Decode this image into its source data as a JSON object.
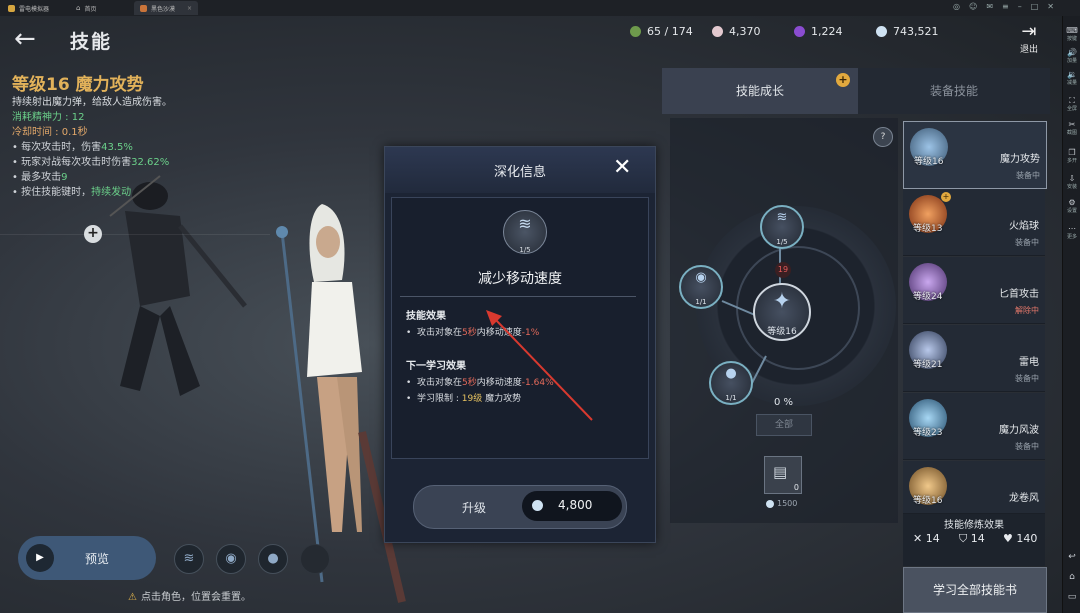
{
  "emulator": {
    "tabs": [
      {
        "label": "雷电模拟器"
      },
      {
        "label": "首页"
      },
      {
        "label": "黑色沙漠"
      }
    ],
    "sidebar": [
      {
        "icon": "keyboard-icon",
        "glyph": "⌨",
        "label": "按键"
      },
      {
        "icon": "volume-up-icon",
        "glyph": "🔊",
        "label": "加量"
      },
      {
        "icon": "volume-down-icon",
        "glyph": "🔉",
        "label": "减量"
      },
      {
        "icon": "fullscreen-icon",
        "glyph": "⛶",
        "label": "全屏"
      },
      {
        "icon": "scissors-icon",
        "glyph": "✂",
        "label": "截图"
      },
      {
        "icon": "multi-open-icon",
        "glyph": "❐",
        "label": "多开"
      },
      {
        "icon": "install-icon",
        "glyph": "⇩",
        "label": "安装"
      },
      {
        "icon": "settings-icon",
        "glyph": "⚙",
        "label": "设置"
      },
      {
        "icon": "more-icon",
        "glyph": "⋯",
        "label": "更多"
      }
    ],
    "nav": [
      {
        "icon": "back-icon",
        "glyph": "↩"
      },
      {
        "icon": "home-icon",
        "glyph": "⌂"
      },
      {
        "icon": "recent-icon",
        "glyph": "▭"
      }
    ]
  },
  "header": {
    "back_glyph": "←",
    "title": "技能",
    "resources": [
      {
        "icon": "energy-icon",
        "value": "65 / 174",
        "color": "#6e9a4c"
      },
      {
        "icon": "pearl-icon",
        "value": "4,370",
        "color": "#e3c9cf"
      },
      {
        "icon": "gem-icon",
        "value": "1,224",
        "color": "#8a4cd0"
      },
      {
        "icon": "silver-icon",
        "value": "743,521",
        "color": "#cfe2f2"
      }
    ],
    "exit_label": "退出"
  },
  "skill_info": {
    "level_name": "等级16 魔力攻势",
    "description": "持续射出魔力弹，给敌人造成伤害。",
    "cost": "消耗精神力 : 12",
    "cooldown": "冷却时间 : 0.1秒",
    "bullets": [
      {
        "text": "每次攻击时，伤害",
        "highlight": "43.5%"
      },
      {
        "text": "玩家对战每次攻击时伤害",
        "highlight": "32.62%"
      },
      {
        "text": "最多攻击",
        "highlight": "9"
      },
      {
        "text": "按住技能键时，",
        "highlight": "持续发动"
      }
    ]
  },
  "bottom_left": {
    "preview_label": "预览",
    "notice": "点击角色，位置会重置。"
  },
  "modal": {
    "title": "深化信息",
    "close": "✕",
    "skill_count": "1/5",
    "skill_name": "减少移动速度",
    "effect_title": "技能效果",
    "effect_line": {
      "pre": "攻击对象在",
      "time": "5秒",
      "mid": "内移动速度",
      "val": "-1%"
    },
    "next_title": "下一学习效果",
    "next_line": {
      "pre": "攻击对象在",
      "time": "5秒",
      "mid": "内移动速度",
      "val": "-1.64%"
    },
    "limit_line": {
      "pre": "学习限制 : ",
      "lv": "19级",
      "post": " 魔力攻势"
    },
    "upgrade_label": "升级",
    "upgrade_cost": "4,800"
  },
  "right_panel": {
    "tab_growth": "技能成长",
    "tab_equip": "装备技能",
    "tree": {
      "top_node": "1/5",
      "left_node": "1/1",
      "bottom_node": "1/1",
      "main_level": "等级16",
      "red_badge": "19",
      "percent": "0 %",
      "all_button": "全部",
      "book_count": "0",
      "book_cost": "1500"
    },
    "skills": [
      {
        "level": "等级16",
        "name": "魔力攻势",
        "status": "装备中",
        "color": "#5f8fb8"
      },
      {
        "level": "等级13",
        "name": "火焰球",
        "status": "装备中",
        "color": "#c25a2a"
      },
      {
        "level": "等级24",
        "name": "匕首攻击",
        "status": "解除中",
        "color": "#8b67b0"
      },
      {
        "level": "等级21",
        "name": "雷电",
        "status": "装备中",
        "color": "#6e7fa3"
      },
      {
        "level": "等级23",
        "name": "魔力风波",
        "status": "装备中",
        "color": "#5d93b9"
      },
      {
        "level": "等级16",
        "name": "龙卷风",
        "status": "",
        "color": "#b58a4d"
      }
    ],
    "training": {
      "title": "技能修炼效果",
      "stats": [
        {
          "icon": "sword-icon",
          "glyph": "✕",
          "value": "14"
        },
        {
          "icon": "shield-icon",
          "glyph": "⛉",
          "value": "14"
        },
        {
          "icon": "heart-icon",
          "glyph": "♥",
          "value": "140"
        }
      ]
    },
    "learn_all": "学习全部技能书"
  }
}
